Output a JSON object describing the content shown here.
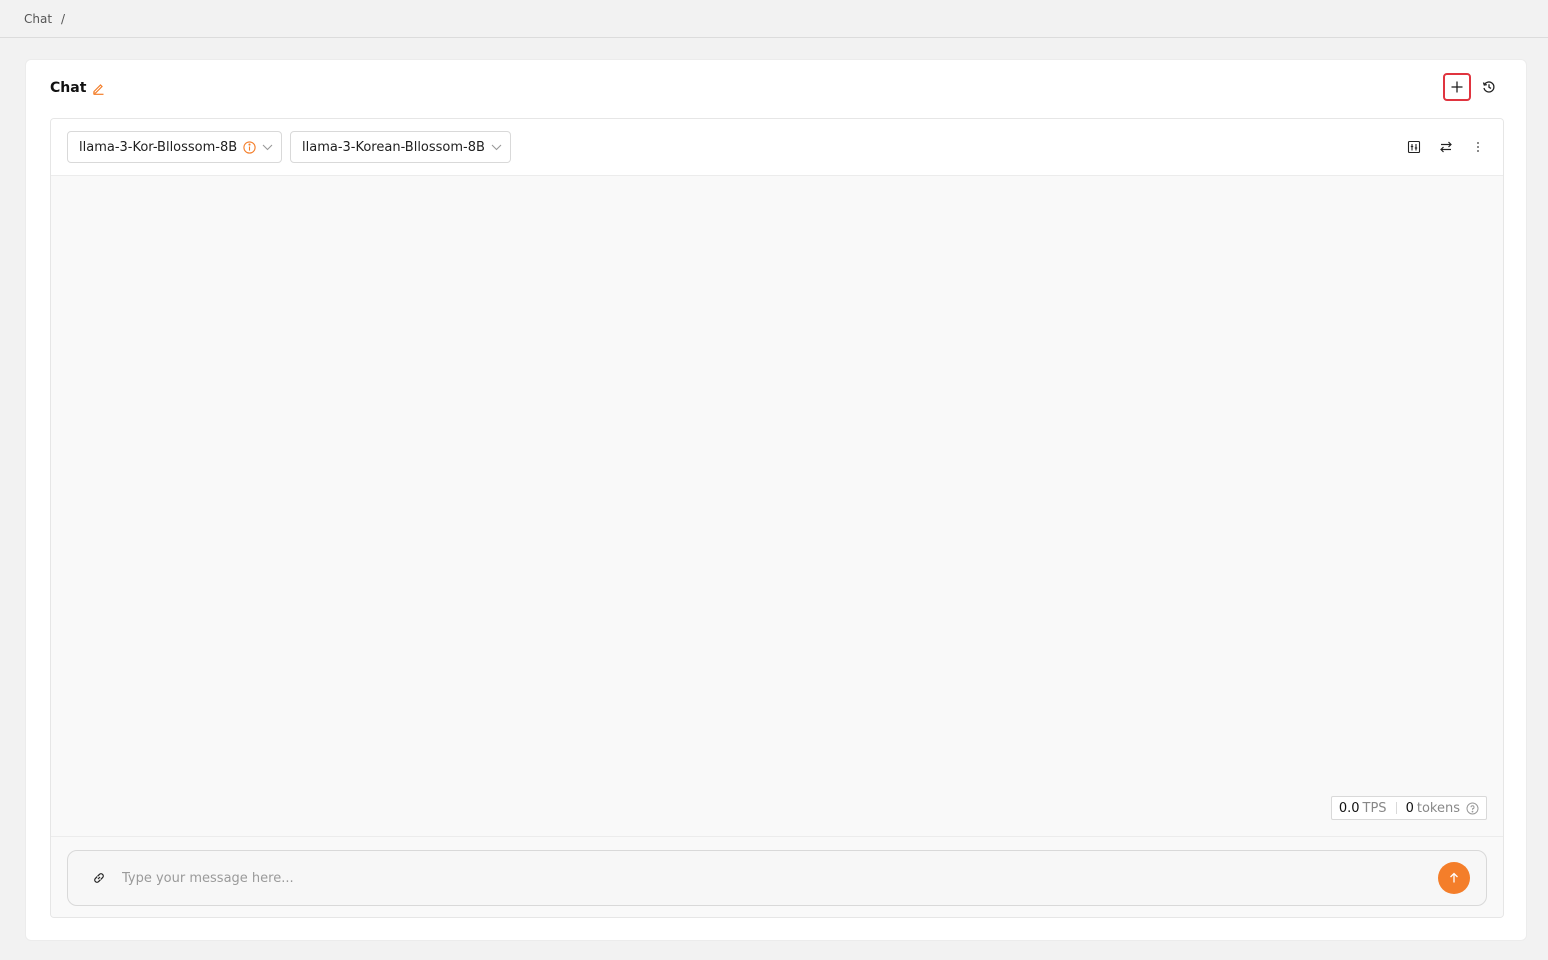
{
  "breadcrumb": {
    "items": [
      "Chat"
    ],
    "separator": "/"
  },
  "header": {
    "title": "Chat"
  },
  "models": [
    {
      "name": "llama-3-Kor-Bllossom-8B",
      "has_info": true
    },
    {
      "name": "llama-3-Korean-Bllossom-8B",
      "has_info": false
    }
  ],
  "stats": {
    "tps_value": "0.0",
    "tps_unit": "TPS",
    "tokens_value": "0",
    "tokens_unit": "tokens"
  },
  "composer": {
    "placeholder": "Type your message here..."
  },
  "colors": {
    "accent": "#f47e2a",
    "highlight": "#e0343f"
  },
  "icons": {
    "edit": "pencil-icon",
    "new_chat": "plus-icon",
    "history": "history-icon",
    "compare": "sliders-icon",
    "swap": "swap-icon",
    "more": "more-vertical-icon",
    "attach": "link-icon",
    "send": "arrow-up-icon",
    "info": "info-icon",
    "help": "question-icon"
  }
}
